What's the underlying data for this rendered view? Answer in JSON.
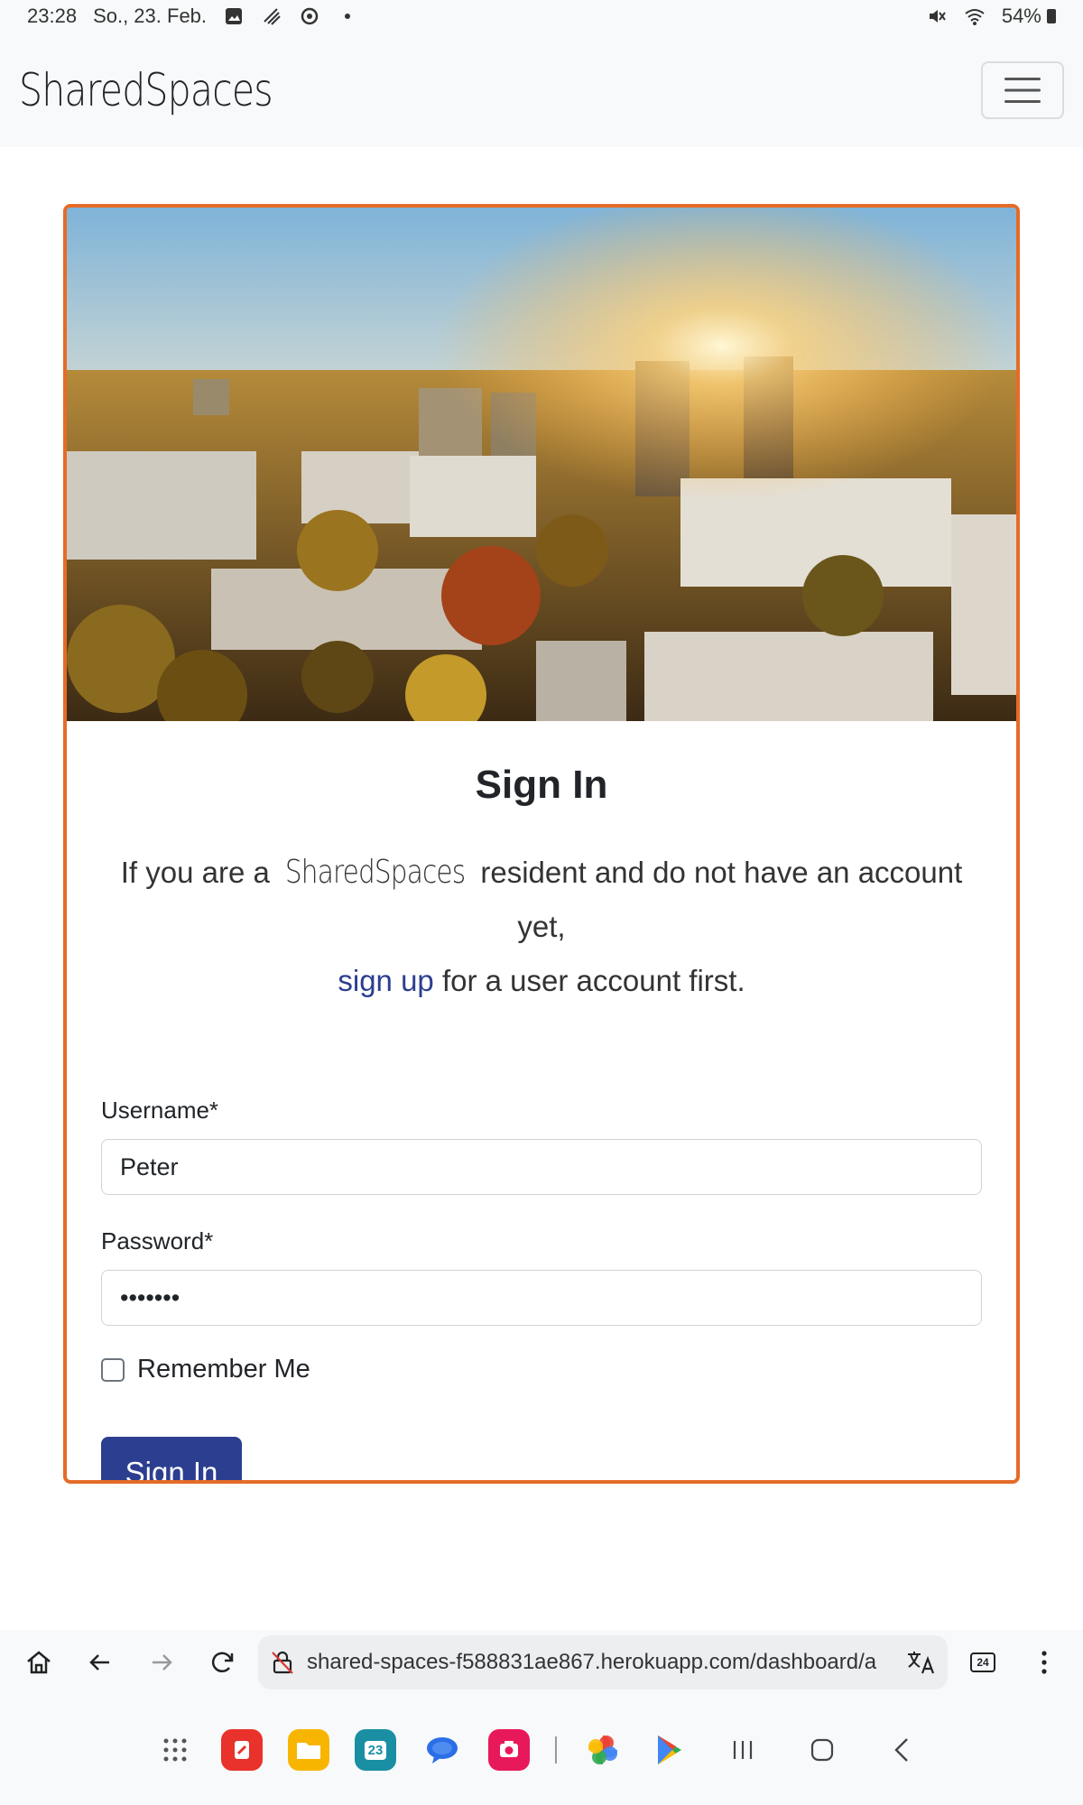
{
  "status_bar": {
    "time": "23:28",
    "date": "So., 23. Feb.",
    "battery": "54%",
    "icons": [
      "gallery-icon",
      "ink-icon",
      "sync-icon",
      "dot-icon",
      "mute-icon",
      "wifi-icon",
      "battery-icon"
    ]
  },
  "navbar": {
    "brand": "SharedSpaces",
    "toggler_icon": "hamburger-icon"
  },
  "card": {
    "title": "Sign In",
    "lead_prefix": "If you are a",
    "lead_brand": "SharedSpaces",
    "lead_middle": "resident and do not have an account yet,",
    "signup_link": "sign up",
    "lead_suffix": "for a user account first.",
    "username_label": "Username*",
    "username_value": "Peter",
    "password_label": "Password*",
    "password_value": "•••••••",
    "remember_label": "Remember Me",
    "submit_label": "Sign In"
  },
  "browser": {
    "url": "shared-spaces-f588831ae867.herokuapp.com/dashboard/a",
    "tab_count": "24",
    "icons": [
      "home-icon",
      "back-icon",
      "forward-icon",
      "reload-icon",
      "insecure-lock-icon",
      "translate-icon",
      "tabs-icon",
      "more-icon"
    ]
  },
  "dock": {
    "apps": [
      "app-grid-icon",
      "notes-app-icon",
      "files-app-icon",
      "calendar-app-icon",
      "messages-app-icon",
      "camera-app-icon",
      "photos-app-icon",
      "play-store-icon"
    ],
    "calendar_day": "23"
  },
  "colors": {
    "accent": "#e56b27",
    "primary": "#2c3e8f",
    "navbar_bg": "#f8f9fa"
  }
}
